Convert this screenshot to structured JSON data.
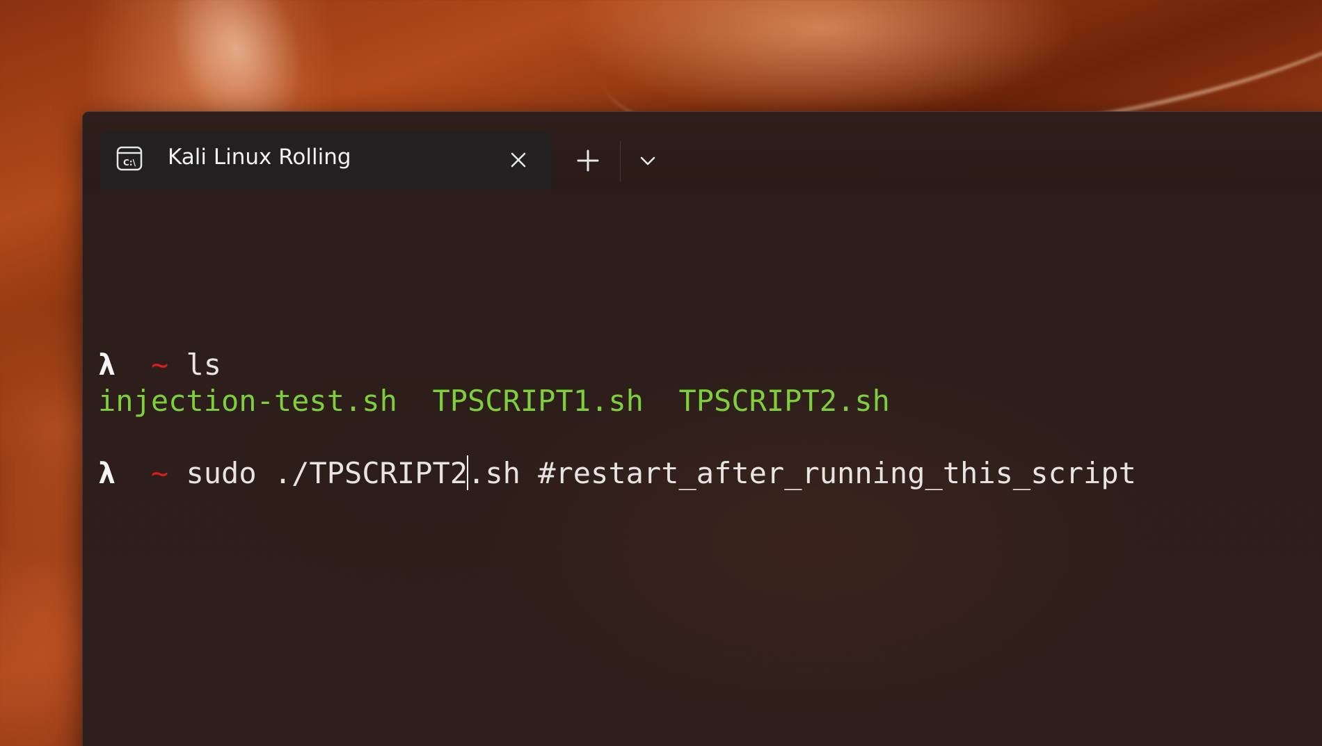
{
  "colors": {
    "prompt_tilde": "#d61e1e",
    "file_green": "#7ed03b",
    "text": "#e8e4e2",
    "tab_bg": "#222020"
  },
  "titlebar": {
    "tab": {
      "icon": "terminal-icon",
      "title": "Kali Linux Rolling",
      "close_icon": "close-icon"
    },
    "new_tab_icon": "plus-icon",
    "dropdown_icon": "chevron-down-icon"
  },
  "terminal": {
    "prompt_symbol": "λ",
    "prompt_dir": "~",
    "lines": [
      {
        "command": "ls"
      },
      {
        "files": [
          "injection-test.sh",
          "TPSCRIPT1.sh",
          "TPSCRIPT2.sh"
        ]
      },
      {
        "command_before_cursor": "sudo ./TPSCRIPT2",
        "command_after_cursor": ".sh #restart_after_running_this_script"
      }
    ]
  }
}
